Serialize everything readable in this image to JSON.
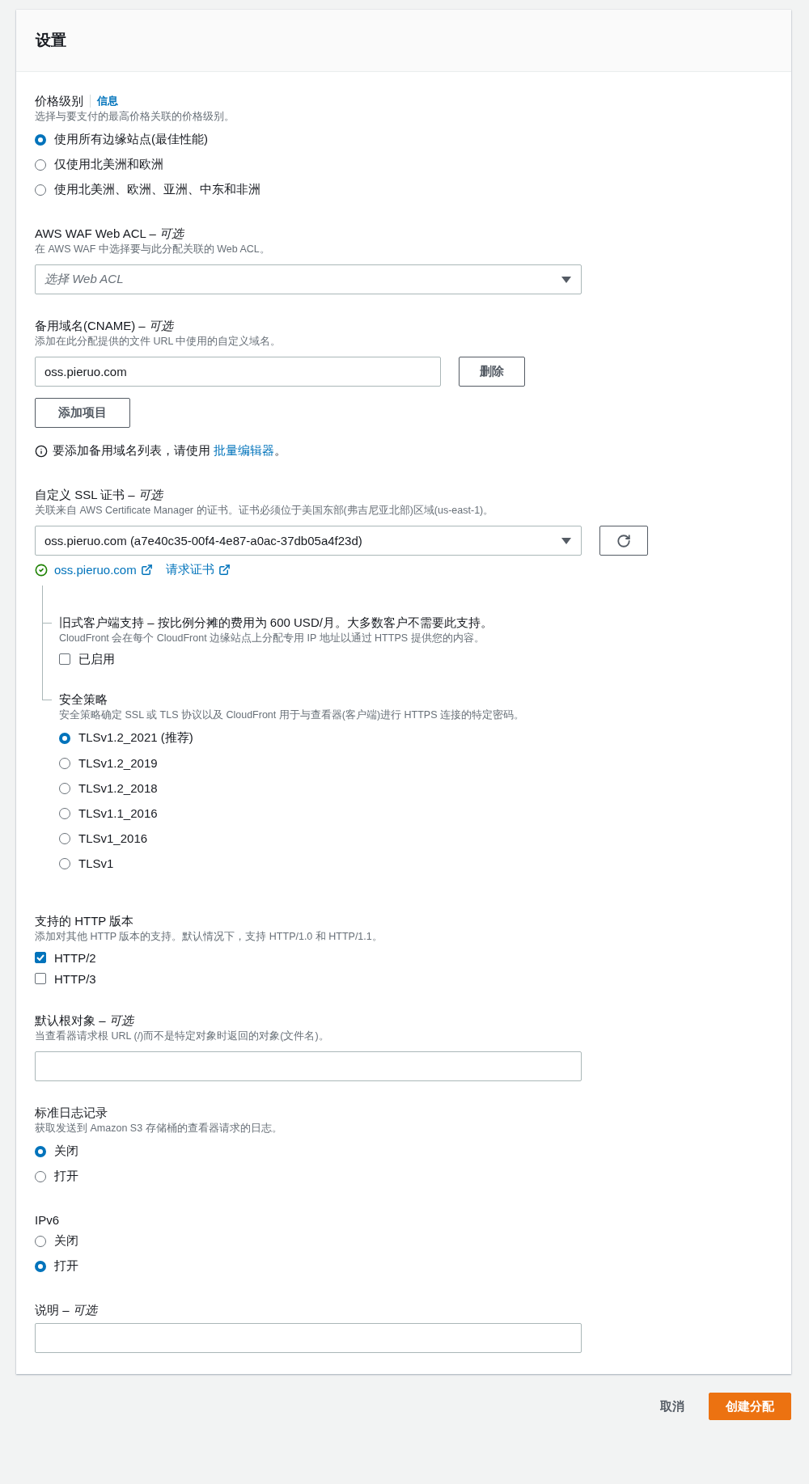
{
  "panel": {
    "title": "设置"
  },
  "sections": [
    {
      "kind": "radio",
      "label": "价格级别",
      "info_link": "信息",
      "description": "选择与要支付的最高价格关联的价格级别。",
      "options": [
        {
          "label": "使用所有边缘站点(最佳性能)",
          "selected": true
        },
        {
          "label": "仅使用北美洲和欧洲",
          "selected": false
        },
        {
          "label": "使用北美洲、欧洲、亚洲、中东和非洲",
          "selected": false
        }
      ]
    },
    {
      "kind": "select",
      "label": "AWS WAF Web ACL – *可选*",
      "description": "在 AWS WAF 中选择要与此分配关联的 Web ACL。",
      "placeholder": "选择 Web ACL"
    },
    {
      "kind": "cname",
      "label": "备用域名(CNAME) – *可选*",
      "description": "添加在此分配提供的文件 URL 中使用的自定义域名。",
      "value": "oss.pieruo.com",
      "remove_button": "删除",
      "add_button": "添加项目",
      "hint": {
        "before": "要添加备用域名列表，请使用 ",
        "link": "批量编辑器",
        "after": "。"
      }
    },
    {
      "kind": "certificate",
      "label": "自定义 SSL 证书 – *可选*",
      "description": "关联来自 AWS Certificate Manager 的证书。证书必须位于美国东部(弗吉尼亚北部)区域(us-east-1)。",
      "value": "oss.pieruo.com (a7e40c35-00f4-4e87-a0ac-37db05a4f23d)",
      "links": [
        "oss.pieruo.com",
        "请求证书"
      ],
      "children": [
        {
          "kind": "checkbox",
          "label": "旧式客户端支持 – 按比例分摊的费用为 600 USD/月。大多数客户不需要此支持。",
          "description": "CloudFront 会在每个 CloudFront 边缘站点上分配专用 IP 地址以通过 HTTPS 提供您的内容。",
          "options": [
            {
              "label": "已启用",
              "checked": false
            }
          ]
        },
        {
          "kind": "radio",
          "label": "安全策略",
          "description": "安全策略确定 SSL 或 TLS 协议以及 CloudFront 用于与查看器(客户端)进行 HTTPS 连接的特定密码。",
          "options": [
            {
              "label": "TLSv1.2_2021 (推荐)",
              "selected": true
            },
            {
              "label": "TLSv1.2_2019",
              "selected": false
            },
            {
              "label": "TLSv1.2_2018",
              "selected": false
            },
            {
              "label": "TLSv1.1_2016",
              "selected": false
            },
            {
              "label": "TLSv1_2016",
              "selected": false
            },
            {
              "label": "TLSv1",
              "selected": false
            }
          ]
        }
      ]
    },
    {
      "kind": "checkbox",
      "label": "支持的 HTTP 版本",
      "description": "添加对其他 HTTP 版本的支持。默认情况下，支持 HTTP/1.0 和 HTTP/1.1。",
      "options": [
        {
          "label": "HTTP/2",
          "checked": true
        },
        {
          "label": "HTTP/3",
          "checked": false
        }
      ]
    },
    {
      "kind": "input",
      "label": "默认根对象 – *可选*",
      "description": "当查看器请求根 URL (/)而不是特定对象时返回的对象(文件名)。"
    },
    {
      "kind": "radio",
      "label": "标准日志记录",
      "description": "获取发送到 Amazon S3 存储桶的查看器请求的日志。",
      "options": [
        {
          "label": "关闭",
          "selected": true
        },
        {
          "label": "打开",
          "selected": false
        }
      ]
    },
    {
      "kind": "radio",
      "label": "IPv6",
      "options": [
        {
          "label": "关闭",
          "selected": false
        },
        {
          "label": "打开",
          "selected": true
        }
      ]
    },
    {
      "kind": "input",
      "label": "说明 – *可选*"
    }
  ],
  "footer": {
    "cancel": "取消",
    "submit": "创建分配"
  }
}
